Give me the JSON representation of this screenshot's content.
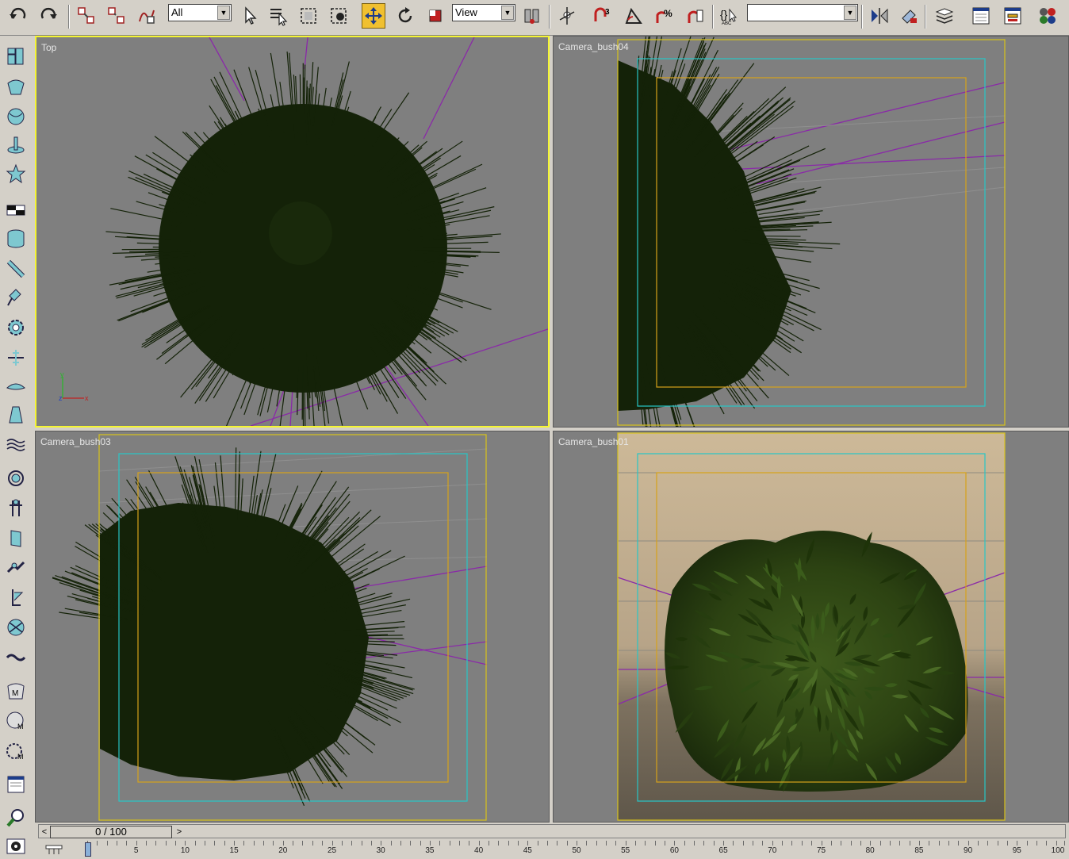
{
  "toolbar": {
    "selection_filter": "All",
    "reference_coord": "View",
    "named_selection": "",
    "icons": [
      "undo-icon",
      "redo-icon",
      "link-icon",
      "unlink-icon",
      "bind-space-warp-icon",
      "select-object-icon",
      "select-by-name-icon",
      "rect-selection-region-icon",
      "window-crossing-icon",
      "select-move-icon",
      "select-rotate-icon",
      "select-scale-icon",
      "use-pivot-center-icon",
      "manipulate-icon",
      "snap-3d-icon",
      "angle-snap-icon",
      "percent-snap-icon",
      "spinner-snap-icon",
      "edit-named-selection-icon",
      "mirror-icon",
      "align-icon",
      "layer-manager-icon",
      "curve-editor-icon",
      "schematic-view-icon",
      "material-editor-icon"
    ]
  },
  "viewports": [
    {
      "label": "Top",
      "active": true,
      "view": "top-wireframe"
    },
    {
      "label": "Camera_bush04",
      "active": false,
      "view": "camera-wireframe"
    },
    {
      "label": "Camera_bush03",
      "active": false,
      "view": "camera-wireframe"
    },
    {
      "label": "Camera_bush01",
      "active": false,
      "view": "camera-shaded"
    }
  ],
  "colors": {
    "viewport_bg": "#7f7f7f",
    "active_border": "#f5f532",
    "bush_wire": "#152209",
    "camera_line": "#8a2aa8",
    "safe_frame_outer": "#d8c21a",
    "safe_frame_action": "#27c6c6",
    "safe_frame_title": "#d6a21a",
    "shaded_bg_top": "#cdb998",
    "shaded_bg_bottom": "#5f574a"
  },
  "axis_tripod": {
    "y": "y",
    "z": "z",
    "x": "x"
  },
  "time_slider": {
    "label": "0 / 100",
    "prev": "<",
    "next": ">"
  },
  "trackbar": {
    "ticks": [
      "0",
      "5",
      "10",
      "15",
      "20",
      "25",
      "30",
      "35",
      "40",
      "45",
      "50",
      "55",
      "60",
      "65",
      "70",
      "75",
      "80",
      "85",
      "90",
      "95",
      "100"
    ]
  },
  "left_panel_icons": [
    "create-icon",
    "modify-icon",
    "hierarchy-icon",
    "motion-icon",
    "display-icon",
    "utilities-icon",
    "cylinder-icon",
    "bone-icon",
    "light-icon",
    "gear-icon",
    "wind-icon",
    "helper-icon",
    "ripple-icon",
    "helix-icon",
    "biped-icon",
    "hair-icon",
    "paint-icon",
    "skin-icon",
    "morph-icon",
    "material-icon",
    "map-icon",
    "reactor-icon",
    "render-icon",
    "zoom-icon",
    "camera-icon"
  ]
}
